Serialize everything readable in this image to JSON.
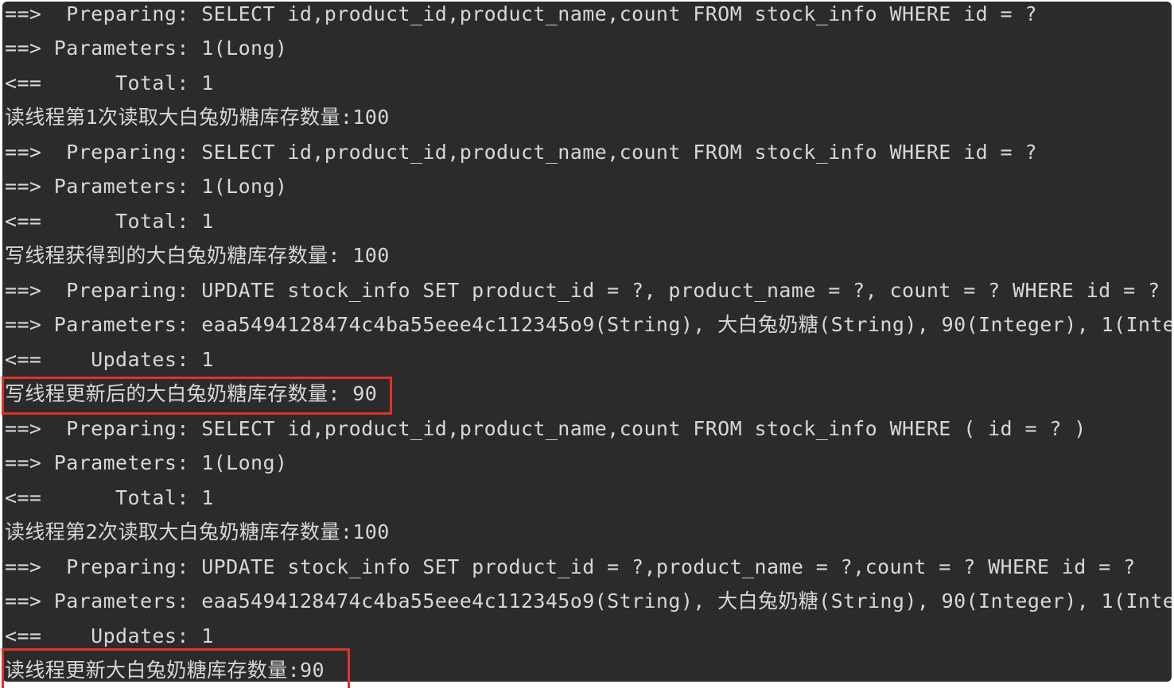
{
  "console": {
    "lines": [
      "==>  Preparing: SELECT id,product_id,product_name,count FROM stock_info WHERE id = ?",
      "==> Parameters: 1(Long)",
      "<==      Total: 1",
      "读线程第1次读取大白兔奶糖库存数量:100",
      "==>  Preparing: SELECT id,product_id,product_name,count FROM stock_info WHERE id = ?",
      "==> Parameters: 1(Long)",
      "<==      Total: 1",
      "写线程获得到的大白兔奶糖库存数量: 100",
      "==>  Preparing: UPDATE stock_info SET product_id = ?, product_name = ?, count = ? WHERE id = ?",
      "==> Parameters: eaa5494128474c4ba55eee4c112345o9(String), 大白兔奶糖(String), 90(Integer), 1(Inte",
      "<==    Updates: 1",
      "写线程更新后的大白兔奶糖库存数量: 90",
      "==>  Preparing: SELECT id,product_id,product_name,count FROM stock_info WHERE ( id = ? )",
      "==> Parameters: 1(Long)",
      "<==      Total: 1",
      "读线程第2次读取大白兔奶糖库存数量:100",
      "==>  Preparing: UPDATE stock_info SET product_id = ?,product_name = ?,count = ? WHERE id = ?",
      "==> Parameters: eaa5494128474c4ba55eee4c112345o9(String), 大白兔奶糖(String), 90(Integer), 1(Inte",
      "<==    Updates: 1",
      "读线程更新大白兔奶糖库存数量:90"
    ]
  },
  "colors": {
    "background": "#2b2b2b",
    "text": "#d7d7d7",
    "highlight": "#e0312c"
  }
}
